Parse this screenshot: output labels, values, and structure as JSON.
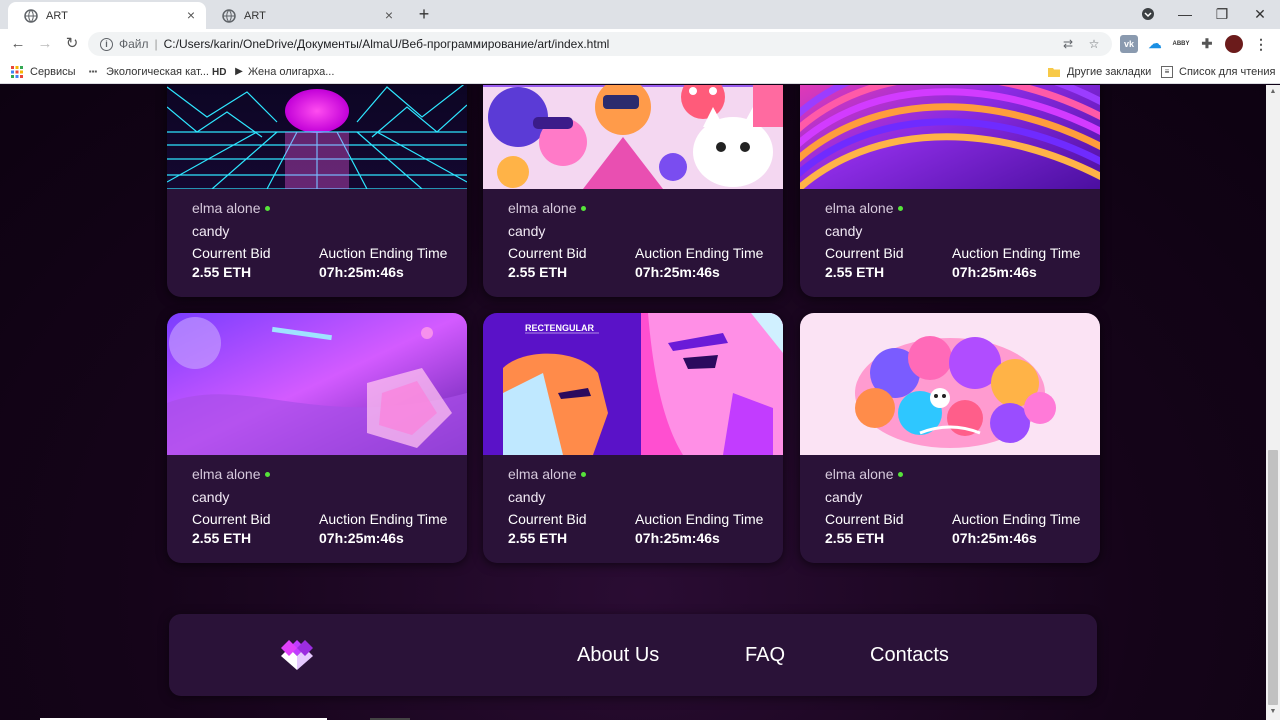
{
  "browser": {
    "tabs": [
      {
        "title": "ART",
        "active": true
      },
      {
        "title": "ART",
        "active": false
      }
    ],
    "url_scheme": "Файл",
    "url": "C:/Users/karin/OneDrive/Документы/AlmaU/Веб-программирование/art/index.html",
    "extensions": [
      "vk",
      "cloud",
      "abbyy",
      "puzzle",
      "profile"
    ],
    "bookmarks": [
      {
        "label": "Сервисы",
        "icon": "apps-grid-icon"
      },
      {
        "label": "Экологическая кат...",
        "icon": "eco-icon"
      },
      {
        "label": "HD",
        "icon": "hd-icon"
      },
      {
        "label": "Жена олигарха...",
        "icon": "play-icon"
      }
    ],
    "other_bookmarks": "Другие закладки",
    "reading_list": "Список для чтения"
  },
  "cards": [
    {
      "author": "elma alone",
      "name": "candy",
      "bid_label": "Courrent Bid",
      "bid_value": "2.55 ETH",
      "time_label": "Auction Ending Time",
      "time_value": "07h:25m:46s",
      "art": "synthwave-grid"
    },
    {
      "author": "elma alone",
      "name": "candy",
      "bid_label": "Courrent Bid",
      "bid_value": "2.55 ETH",
      "time_label": "Auction Ending Time",
      "time_value": "07h:25m:46s",
      "art": "cartoon-characters"
    },
    {
      "author": "elma alone",
      "name": "candy",
      "bid_label": "Courrent Bid",
      "bid_value": "2.55 ETH",
      "time_label": "Auction Ending Time",
      "time_value": "07h:25m:46s",
      "art": "abstract-swirl"
    },
    {
      "author": "elma alone",
      "name": "candy",
      "bid_label": "Courrent Bid",
      "bid_value": "2.55 ETH",
      "time_label": "Auction Ending Time",
      "time_value": "07h:25m:46s",
      "art": "crystal-holographic"
    },
    {
      "author": "elma alone",
      "name": "candy",
      "bid_label": "Courrent Bid",
      "bid_value": "2.55 ETH",
      "time_label": "Auction Ending Time",
      "time_value": "07h:25m:46s",
      "art": "rectengular-faces",
      "art_text": "RECTENGULAR"
    },
    {
      "author": "elma alone",
      "name": "candy",
      "bid_label": "Courrent Bid",
      "bid_value": "2.55 ETH",
      "time_label": "Auction Ending Time",
      "time_value": "07h:25m:46s",
      "art": "colorful-blobs"
    }
  ],
  "footer": {
    "logo": "heart-logo-icon",
    "links": [
      "About Us",
      "FAQ",
      "Contacts"
    ]
  },
  "colors": {
    "page_bg": "#110318",
    "card_bg": "#2a1238",
    "online_dot": "#56e33a",
    "accent": "#e040fb"
  }
}
